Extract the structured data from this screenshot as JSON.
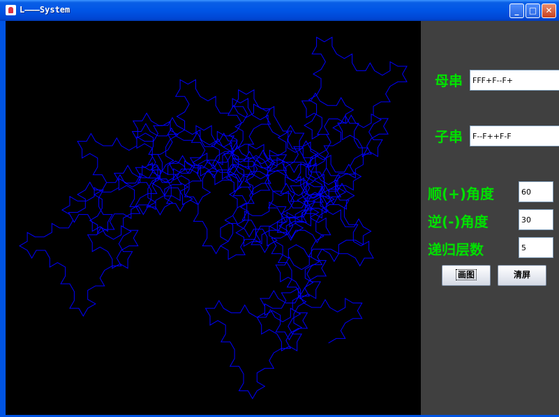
{
  "window": {
    "title": "L———System",
    "minimize_glyph": "_",
    "maximize_glyph": "□",
    "close_glyph": "✕"
  },
  "controls": {
    "mother_label": "母串",
    "mother_value": "FFF+F--F+",
    "child_label": "子串",
    "child_value": "F--F++F-F",
    "cw_label": "顺(+)角度",
    "cw_value": "60",
    "ccw_label": "逆(-)角度",
    "ccw_value": "30",
    "depth_label": "递归层数",
    "depth_value": "5",
    "draw_button": "画图",
    "clear_button": "清屏"
  },
  "colors": {
    "canvas_bg": "#000000",
    "stroke": "#0000ff",
    "label": "#00e000",
    "panel_bg": "#404040"
  },
  "icons": {
    "app": "java-cup-icon",
    "minimize": "minimize-icon",
    "maximize": "maximize-icon",
    "close": "close-icon"
  }
}
